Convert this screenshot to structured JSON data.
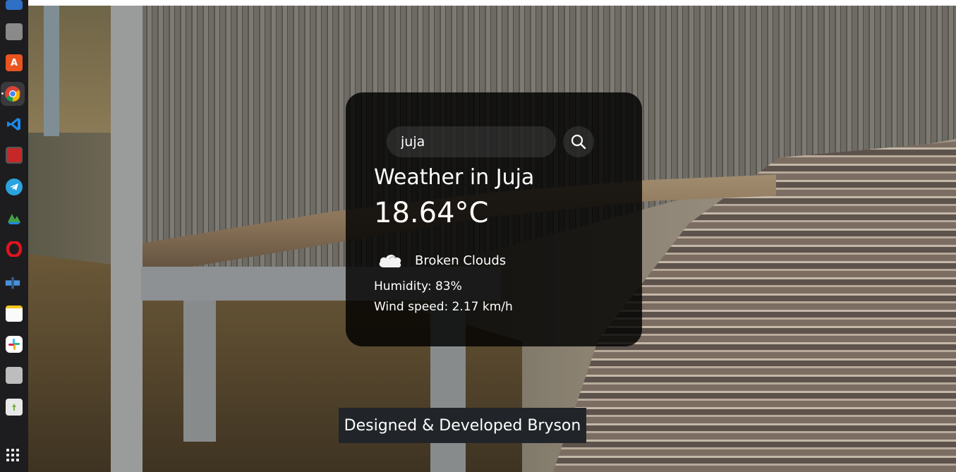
{
  "dock": {
    "apps": [
      {
        "name": "text-editor-icon",
        "color": "#2f6fc5"
      },
      {
        "name": "files-icon",
        "color": "#8a8a8a"
      },
      {
        "name": "app-center-icon",
        "color": "#e95420"
      },
      {
        "name": "chrome-icon",
        "color": "#4285f4"
      },
      {
        "name": "vscode-icon",
        "color": "#0a7acc"
      },
      {
        "name": "screen-recorder-icon",
        "color": "#c62828"
      },
      {
        "name": "telegram-icon",
        "color": "#2aa3df"
      },
      {
        "name": "metatrader-icon",
        "color": "#2e7d32"
      },
      {
        "name": "opera-icon",
        "color": "#e0141e"
      },
      {
        "name": "network-tool-icon",
        "color": "#4a90d9"
      },
      {
        "name": "notes-icon",
        "color": "#f5c518"
      },
      {
        "name": "slack-icon",
        "color": "#ecb22e"
      },
      {
        "name": "disks-icon",
        "color": "#9e9e9e"
      },
      {
        "name": "trash-icon",
        "color": "#7cb342"
      }
    ],
    "show_apps_icon": "grid-icon"
  },
  "weather": {
    "search": {
      "value": "juja",
      "icon": "search-icon"
    },
    "city_title": "Weather in Juja",
    "temperature": "18.64°C",
    "description": "Broken Clouds",
    "condition_icon": "cloud-icon",
    "humidity": "Humidity: 83%",
    "wind": "Wind speed: 2.17 km/h"
  },
  "footer": {
    "text": "Designed & Developed Bryson"
  },
  "colors": {
    "card_bg": "#000000cc",
    "footer_bg": "#212529",
    "text": "#ffffff"
  }
}
